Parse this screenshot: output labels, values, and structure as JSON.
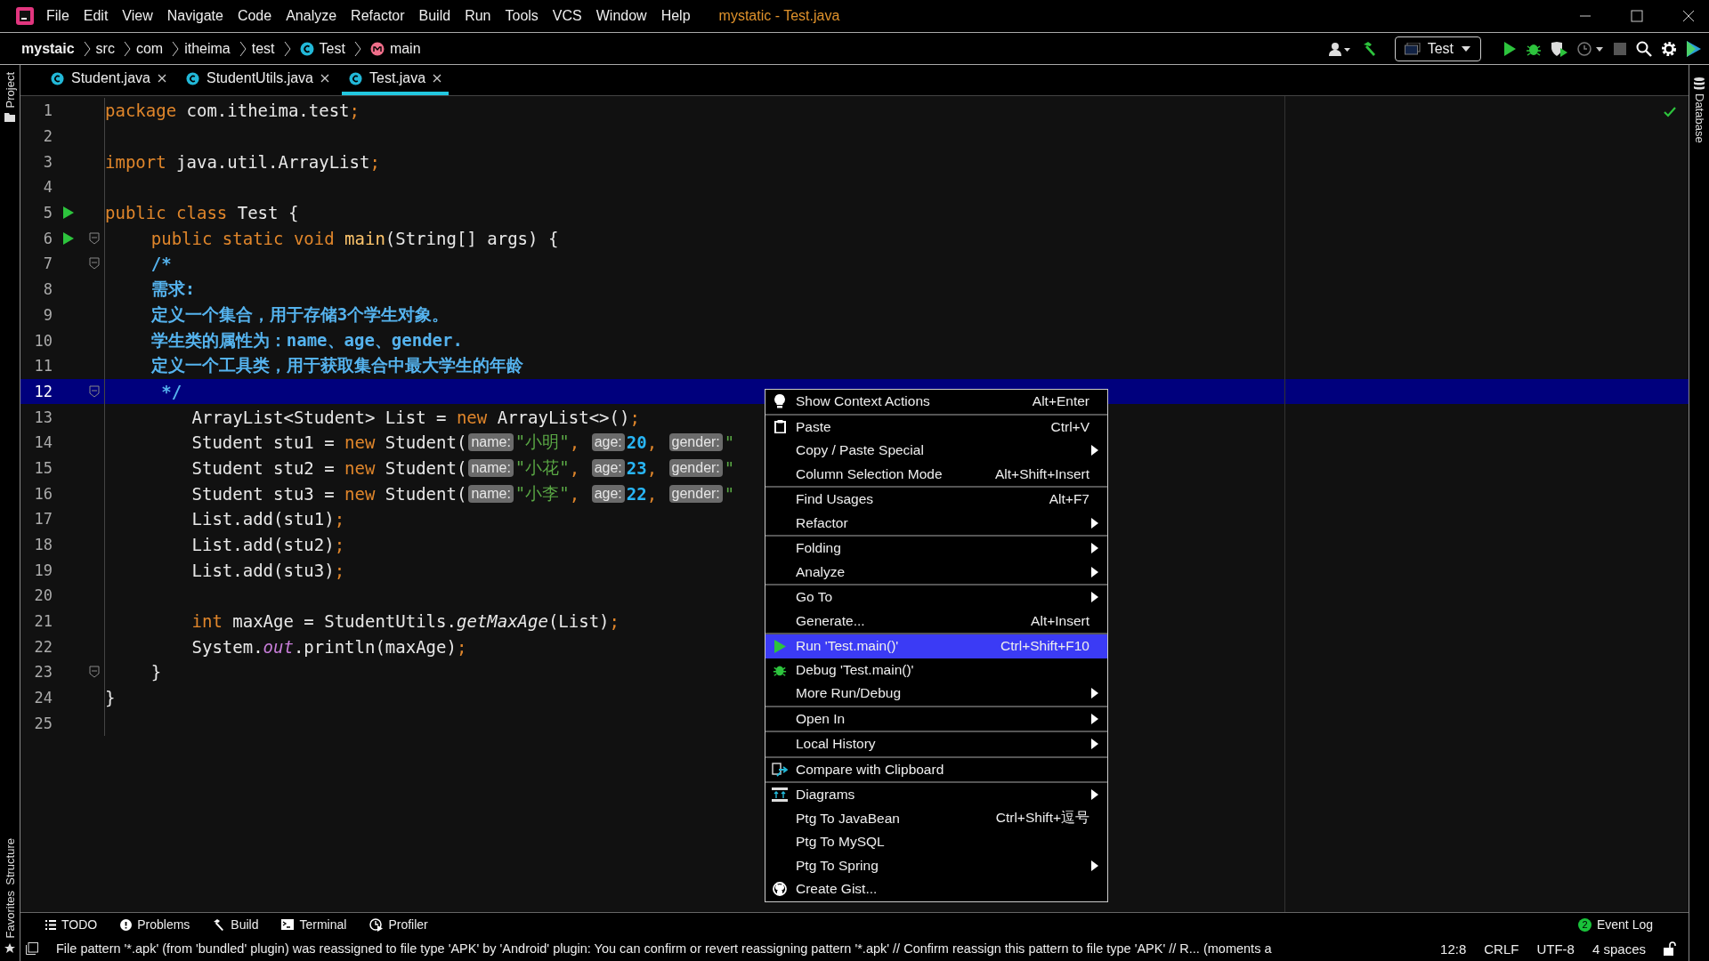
{
  "window": {
    "title": "mystatic - Test.java"
  },
  "menu_bar": [
    "File",
    "Edit",
    "View",
    "Navigate",
    "Code",
    "Analyze",
    "Refactor",
    "Build",
    "Run",
    "Tools",
    "VCS",
    "Window",
    "Help"
  ],
  "breadcrumbs": [
    {
      "label": "mystaic",
      "kind": "project"
    },
    {
      "label": "src",
      "kind": "folder"
    },
    {
      "label": "com",
      "kind": "folder"
    },
    {
      "label": "itheima",
      "kind": "folder"
    },
    {
      "label": "test",
      "kind": "folder"
    },
    {
      "label": "Test",
      "kind": "class"
    },
    {
      "label": "main",
      "kind": "method"
    }
  ],
  "run_config": {
    "label": "Test"
  },
  "tabs": [
    {
      "label": "Student.java",
      "selected": false
    },
    {
      "label": "StudentUtils.java",
      "selected": false
    },
    {
      "label": "Test.java",
      "selected": true
    }
  ],
  "left_tool_windows": {
    "top": [
      "Project"
    ],
    "bottom": [
      "Structure",
      "Favorites"
    ]
  },
  "right_tool_windows": [
    "Database"
  ],
  "code_lines": [
    {
      "number": "1",
      "kind": "file",
      "selected": false,
      "run": false,
      "fold": false,
      "tokens": [
        {
          "kind": "kw",
          "text": "package "
        },
        {
          "kind": "plain",
          "text": "com.itheima.test"
        },
        {
          "kind": "kw",
          "text": ";"
        }
      ]
    },
    {
      "number": "2",
      "kind": "file",
      "selected": false,
      "run": false,
      "fold": false
    },
    {
      "number": "3",
      "kind": "file",
      "selected": false,
      "run": false,
      "fold": false,
      "tokens": [
        {
          "kind": "kw",
          "text": "import "
        },
        {
          "kind": "plain",
          "text": "java.util.ArrayList"
        },
        {
          "kind": "kw",
          "text": ";"
        }
      ]
    },
    {
      "number": "4",
      "kind": "file",
      "selected": false,
      "run": false,
      "fold": false
    },
    {
      "number": "5",
      "kind": "file",
      "selected": false,
      "run": true,
      "fold": false,
      "tokens": [
        {
          "kind": "kw",
          "text": "public class "
        },
        {
          "kind": "plain",
          "text": "Test {"
        }
      ]
    },
    {
      "number": "6",
      "kind": "class",
      "selected": false,
      "run": true,
      "fold": true,
      "tokens": [
        {
          "kind": "kw",
          "text": "public static void "
        },
        {
          "kind": "method",
          "text": "main"
        },
        {
          "kind": "plain",
          "text": "(String[] args) {"
        }
      ]
    },
    {
      "number": "7",
      "kind": "class",
      "selected": false,
      "run": false,
      "fold": true,
      "tokens": [
        {
          "kind": "comment",
          "text": "/*"
        }
      ]
    },
    {
      "number": "8",
      "kind": "class",
      "selected": false,
      "run": false,
      "fold": false,
      "tokens": [
        {
          "kind": "comment",
          "text": "需求:"
        }
      ]
    },
    {
      "number": "9",
      "kind": "class",
      "selected": false,
      "run": false,
      "fold": false,
      "tokens": [
        {
          "kind": "comment",
          "text": "定义一个集合，用于存储3个学生对象。"
        }
      ]
    },
    {
      "number": "10",
      "kind": "class",
      "selected": false,
      "run": false,
      "fold": false,
      "tokens": [
        {
          "kind": "comment",
          "text": "学生类的属性为：name、age、gender."
        }
      ]
    },
    {
      "number": "11",
      "kind": "class",
      "selected": false,
      "run": false,
      "fold": false,
      "tokens": [
        {
          "kind": "comment",
          "text": "定义一个工具类，用于获取集合中最大学生的年龄"
        }
      ]
    },
    {
      "number": "12",
      "kind": "comment_end",
      "selected": true,
      "run": false,
      "fold": true,
      "tokens": [
        {
          "kind": "comment",
          "text": "*/"
        }
      ]
    },
    {
      "number": "13",
      "kind": "method",
      "selected": false,
      "run": false,
      "fold": false,
      "tokens": [
        {
          "kind": "plain",
          "text": "ArrayList<Student> List = "
        },
        {
          "kind": "kw",
          "text": "new "
        },
        {
          "kind": "plain",
          "text": "ArrayList<>()"
        },
        {
          "kind": "kw",
          "text": ";"
        }
      ]
    },
    {
      "number": "14",
      "kind": "method",
      "selected": false,
      "run": false,
      "fold": false,
      "tokens": [
        {
          "kind": "plain",
          "text": "Student stu1 = "
        },
        {
          "kind": "kw",
          "text": "new "
        },
        {
          "kind": "plain",
          "text": "Student("
        },
        {
          "kind": "hint",
          "text": "name:"
        },
        {
          "kind": "string",
          "text": "\"小明\""
        },
        {
          "kind": "kw",
          "text": ", "
        },
        {
          "kind": "hint",
          "text": "age:"
        },
        {
          "kind": "number",
          "text": "20"
        },
        {
          "kind": "kw",
          "text": ", "
        },
        {
          "kind": "hint",
          "text": "gender:"
        },
        {
          "kind": "string",
          "text": "\""
        }
      ]
    },
    {
      "number": "15",
      "kind": "method",
      "selected": false,
      "run": false,
      "fold": false,
      "tokens": [
        {
          "kind": "plain",
          "text": "Student stu2 = "
        },
        {
          "kind": "kw",
          "text": "new "
        },
        {
          "kind": "plain",
          "text": "Student("
        },
        {
          "kind": "hint",
          "text": "name:"
        },
        {
          "kind": "string",
          "text": "\"小花\""
        },
        {
          "kind": "kw",
          "text": ", "
        },
        {
          "kind": "hint",
          "text": "age:"
        },
        {
          "kind": "number",
          "text": "23"
        },
        {
          "kind": "kw",
          "text": ", "
        },
        {
          "kind": "hint",
          "text": "gender:"
        },
        {
          "kind": "string",
          "text": "\""
        }
      ]
    },
    {
      "number": "16",
      "kind": "method",
      "selected": false,
      "run": false,
      "fold": false,
      "tokens": [
        {
          "kind": "plain",
          "text": "Student stu3 = "
        },
        {
          "kind": "kw",
          "text": "new "
        },
        {
          "kind": "plain",
          "text": "Student("
        },
        {
          "kind": "hint",
          "text": "name:"
        },
        {
          "kind": "string",
          "text": "\"小李\""
        },
        {
          "kind": "kw",
          "text": ", "
        },
        {
          "kind": "hint",
          "text": "age:"
        },
        {
          "kind": "number",
          "text": "22"
        },
        {
          "kind": "kw",
          "text": ", "
        },
        {
          "kind": "hint",
          "text": "gender:"
        },
        {
          "kind": "string",
          "text": "\""
        }
      ]
    },
    {
      "number": "17",
      "kind": "method",
      "selected": false,
      "run": false,
      "fold": false,
      "tokens": [
        {
          "kind": "plain",
          "text": "List.add(stu1)"
        },
        {
          "kind": "kw",
          "text": ";"
        }
      ]
    },
    {
      "number": "18",
      "kind": "method",
      "selected": false,
      "run": false,
      "fold": false,
      "tokens": [
        {
          "kind": "plain",
          "text": "List.add(stu2)"
        },
        {
          "kind": "kw",
          "text": ";"
        }
      ]
    },
    {
      "number": "19",
      "kind": "method",
      "selected": false,
      "run": false,
      "fold": false,
      "tokens": [
        {
          "kind": "plain",
          "text": "List.add(stu3)"
        },
        {
          "kind": "kw",
          "text": ";"
        }
      ]
    },
    {
      "number": "20",
      "kind": "method",
      "selected": false,
      "run": false,
      "fold": false
    },
    {
      "number": "21",
      "kind": "method",
      "selected": false,
      "run": false,
      "fold": false,
      "tokens": [
        {
          "kind": "kw",
          "text": "int "
        },
        {
          "kind": "plain",
          "text": "maxAge = StudentUtils."
        },
        {
          "kind": "italic",
          "text": "getMaxAge"
        },
        {
          "kind": "plain",
          "text": "(List)"
        },
        {
          "kind": "kw",
          "text": ";"
        }
      ]
    },
    {
      "number": "22",
      "kind": "method",
      "selected": false,
      "run": false,
      "fold": false,
      "tokens": [
        {
          "kind": "plain",
          "text": "System."
        },
        {
          "kind": "field",
          "text": "out"
        },
        {
          "kind": "plain",
          "text": ".println(maxAge)"
        },
        {
          "kind": "kw",
          "text": ";"
        }
      ]
    },
    {
      "number": "23",
      "kind": "class",
      "selected": false,
      "run": false,
      "fold": true,
      "tokens": [
        {
          "kind": "plain",
          "text": "}"
        }
      ]
    },
    {
      "number": "24",
      "kind": "file",
      "selected": false,
      "run": false,
      "fold": false,
      "tokens": [
        {
          "kind": "plain",
          "text": "}"
        }
      ]
    },
    {
      "number": "25",
      "kind": "file",
      "selected": false,
      "run": false,
      "fold": false
    }
  ],
  "context_menu": [
    [
      {
        "label": "Show Context Actions",
        "shortcut": "Alt+Enter",
        "kind": "bulb",
        "submenu": false,
        "selected": false
      }
    ],
    [
      {
        "label": "Paste",
        "shortcut": "Ctrl+V",
        "kind": "clipboard",
        "submenu": false,
        "selected": false
      },
      {
        "label": "Copy / Paste Special",
        "kind": "plain",
        "submenu": true,
        "selected": false
      },
      {
        "label": "Column Selection Mode",
        "shortcut": "Alt+Shift+Insert",
        "kind": "plain",
        "submenu": false,
        "selected": false
      }
    ],
    [
      {
        "label": "Find Usages",
        "shortcut": "Alt+F7",
        "kind": "plain",
        "submenu": false,
        "selected": false
      },
      {
        "label": "Refactor",
        "kind": "plain",
        "submenu": true,
        "selected": false
      }
    ],
    [
      {
        "label": "Folding",
        "kind": "plain",
        "submenu": true,
        "selected": false
      },
      {
        "label": "Analyze",
        "kind": "plain",
        "submenu": true,
        "selected": false
      }
    ],
    [
      {
        "label": "Go To",
        "kind": "plain",
        "submenu": true,
        "selected": false
      },
      {
        "label": "Generate...",
        "shortcut": "Alt+Insert",
        "kind": "plain",
        "submenu": false,
        "selected": false
      }
    ],
    [
      {
        "label": "Run 'Test.main()'",
        "shortcut": "Ctrl+Shift+F10",
        "kind": "run",
        "submenu": false,
        "selected": true
      },
      {
        "label": "Debug 'Test.main()'",
        "kind": "debug",
        "submenu": false,
        "selected": false
      },
      {
        "label": "More Run/Debug",
        "kind": "plain",
        "submenu": true,
        "selected": false
      }
    ],
    [
      {
        "label": "Open In",
        "kind": "plain",
        "submenu": true,
        "selected": false
      }
    ],
    [
      {
        "label": "Local History",
        "kind": "plain",
        "submenu": true,
        "selected": false
      }
    ],
    [
      {
        "label": "Compare with Clipboard",
        "kind": "compare",
        "submenu": false,
        "selected": false
      }
    ],
    [
      {
        "label": "Diagrams",
        "kind": "diagram",
        "submenu": true,
        "selected": false
      },
      {
        "label": "Ptg To JavaBean",
        "shortcut": "Ctrl+Shift+逗号",
        "kind": "plain",
        "submenu": false,
        "selected": false
      },
      {
        "label": "Ptg To MySQL",
        "kind": "plain",
        "submenu": false,
        "selected": false
      },
      {
        "label": "Ptg To Spring",
        "kind": "plain",
        "submenu": true,
        "selected": false
      },
      {
        "label": "Create Gist...",
        "kind": "github",
        "submenu": false,
        "selected": false
      }
    ]
  ],
  "bottom_tools": [
    {
      "label": "TODO",
      "kind": "list"
    },
    {
      "label": "Problems",
      "kind": "alert"
    },
    {
      "label": "Build",
      "kind": "hammer"
    },
    {
      "label": "Terminal",
      "kind": "terminal"
    },
    {
      "label": "Profiler",
      "kind": "profiler"
    }
  ],
  "event_log": {
    "label": "Event Log",
    "count": "2"
  },
  "status_bar": {
    "message": "File pattern '*.apk' (from 'bundled' plugin) was reassigned to file type 'APK' by 'Android' plugin: You can confirm or revert reassigning pattern '*.apk' // Confirm reassign this pattern to file type 'APK' // R... (moments a",
    "position": "12:8",
    "line_separator": "CRLF",
    "encoding": "UTF-8",
    "indent": "4 spaces"
  }
}
